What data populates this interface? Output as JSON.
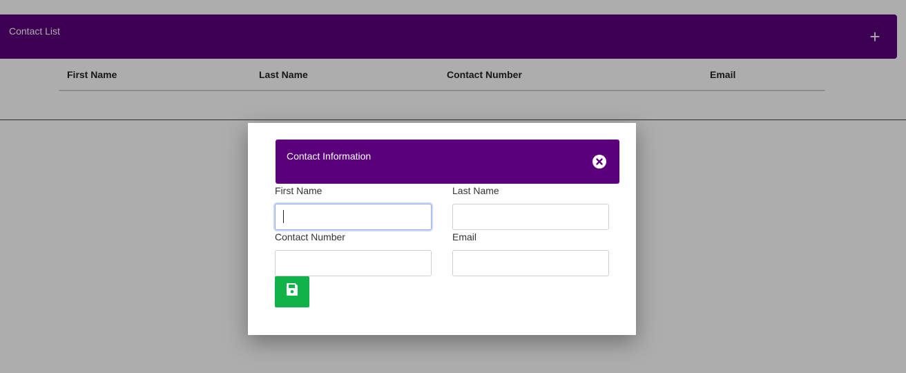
{
  "page": {
    "title": "Contact List",
    "add_icon": "plus-icon",
    "table": {
      "columns": [
        "First Name",
        "Last Name",
        "Contact Number",
        "Email"
      ],
      "rows": []
    }
  },
  "modal": {
    "title": "Contact Information",
    "close_icon": "close-circle-icon",
    "fields": {
      "first_name": {
        "label": "First Name",
        "value": ""
      },
      "last_name": {
        "label": "Last Name",
        "value": ""
      },
      "contact_number": {
        "label": "Contact Number",
        "value": ""
      },
      "email": {
        "label": "Email",
        "value": ""
      }
    },
    "save_icon": "floppy-disk-icon"
  },
  "colors": {
    "header_purple": "#5b007a",
    "save_green": "#12b24a"
  }
}
